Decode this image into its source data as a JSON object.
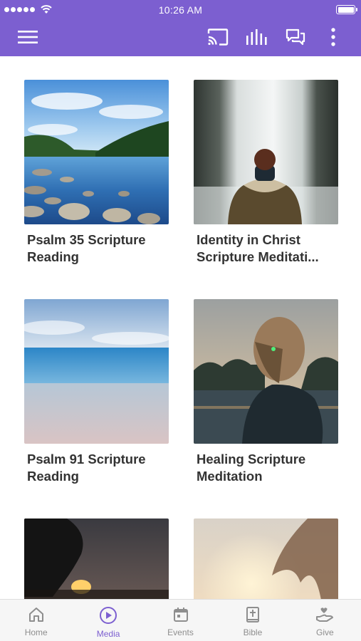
{
  "status_bar": {
    "time": "10:26 AM"
  },
  "colors": {
    "brand": "#7c5fd0",
    "tab_inactive": "#8e8e8e",
    "tab_active": "#7c5fd0"
  },
  "header": {
    "icons": [
      "menu-icon",
      "cast-icon",
      "audio-bars-icon",
      "chat-icon",
      "more-vertical-icon"
    ]
  },
  "media": {
    "items": [
      {
        "title": "Psalm 35 Scripture Reading",
        "image": "lake-landscape"
      },
      {
        "title": "Identity in Christ Scripture Meditati...",
        "image": "waterfall-person"
      },
      {
        "title": "Psalm 91 Scripture Reading",
        "image": "ocean-beach"
      },
      {
        "title": "Healing Scripture Meditation",
        "image": "girl-sunset-lake"
      },
      {
        "title": "",
        "image": "sunset-silhouette"
      },
      {
        "title": "",
        "image": "hair-sunset"
      }
    ]
  },
  "tabs": [
    {
      "label": "Home",
      "icon": "home-icon",
      "active": false
    },
    {
      "label": "Media",
      "icon": "play-circle-icon",
      "active": true
    },
    {
      "label": "Events",
      "icon": "calendar-icon",
      "active": false
    },
    {
      "label": "Bible",
      "icon": "bible-icon",
      "active": false
    },
    {
      "label": "Give",
      "icon": "give-hand-icon",
      "active": false
    }
  ]
}
